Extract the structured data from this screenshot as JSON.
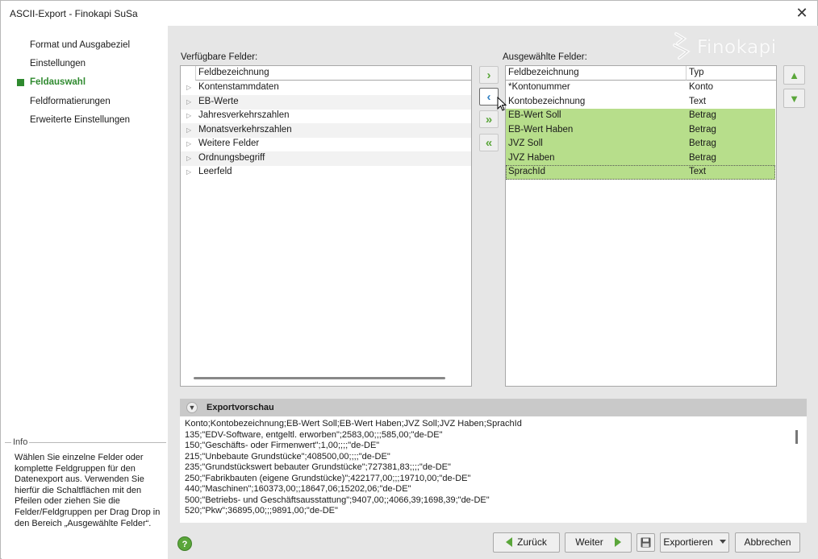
{
  "window": {
    "title": "ASCII-Export - Finokapi SuSa",
    "close_glyph": "✕"
  },
  "sidebar": {
    "items": [
      {
        "label": "Format und Ausgabeziel",
        "active": false
      },
      {
        "label": "Einstellungen",
        "active": false
      },
      {
        "label": "Feldauswahl",
        "active": true
      },
      {
        "label": "Feldformatierungen",
        "active": false
      },
      {
        "label": "Erweiterte Einstellungen",
        "active": false
      }
    ],
    "info": {
      "title": "Info",
      "text": "Wählen Sie einzelne Felder oder komplette Feldgruppen für den Datenexport aus. Verwenden Sie hierfür die Schaltflächen mit den Pfeilen oder ziehen Sie die Felder/Feldgruppen per Drag Drop in den Bereich „Ausgewählte Felder“."
    }
  },
  "brand": {
    "logo_text": "Finokapi",
    "accent": "#5aa63a",
    "highlight": "#b7de8b"
  },
  "available": {
    "label": "Verfügbare Felder:",
    "column": "Feldbezeichnung",
    "items": [
      "Kontenstammdaten",
      "EB-Werte",
      "Jahresverkehrszahlen",
      "Monatsverkehrszahlen",
      "Weitere Felder",
      "Ordnungsbegriff",
      "Leerfeld"
    ]
  },
  "selected": {
    "label": "Ausgewählte Felder:",
    "columns": [
      "Feldbezeichnung",
      "Typ"
    ],
    "rows": [
      {
        "name": "*Kontonummer",
        "type": "Konto",
        "highlighted": false
      },
      {
        "name": "Kontobezeichnung",
        "type": "Text",
        "highlighted": false
      },
      {
        "name": "EB-Wert Soll",
        "type": "Betrag",
        "highlighted": true
      },
      {
        "name": "EB-Wert Haben",
        "type": "Betrag",
        "highlighted": true
      },
      {
        "name": "JVZ Soll",
        "type": "Betrag",
        "highlighted": true
      },
      {
        "name": "JVZ Haben",
        "type": "Betrag",
        "highlighted": true
      },
      {
        "name": "SprachId",
        "type": "Text",
        "highlighted": true
      }
    ]
  },
  "move_buttons": {
    "add": "›",
    "remove": "‹",
    "add_all": "»",
    "remove_all": "«"
  },
  "order_buttons": {
    "up": "▲",
    "down": "▼"
  },
  "preview": {
    "title": "Exportvorschau",
    "lines": [
      "Konto;Kontobezeichnung;EB-Wert Soll;EB-Wert Haben;JVZ Soll;JVZ Haben;SprachId",
      "135;\"EDV-Software, entgeltl. erworben\";2583,00;;;585,00;\"de-DE\"",
      "150;\"Geschäfts- oder Firmenwert\";1,00;;;;\"de-DE\"",
      "215;\"Unbebaute Grundstücke\";408500,00;;;;\"de-DE\"",
      "235;\"Grundstückswert bebauter Grundstücke\";727381,83;;;;\"de-DE\"",
      "250;\"Fabrikbauten (eigene Grundstücke)\";422177,00;;;19710,00;\"de-DE\"",
      "440;\"Maschinen\";160373,00;;18647,06;15202,06;\"de-DE\"",
      "500;\"Betriebs- und Geschäftsausstattung\";9407,00;;4066,39;1698,39;\"de-DE\"",
      "520;\"Pkw\";36895,00;;;9891,00;\"de-DE\""
    ]
  },
  "footer": {
    "help": "?",
    "back": "Zurück",
    "next": "Weiter",
    "export": "Exportieren",
    "cancel": "Abbrechen"
  }
}
